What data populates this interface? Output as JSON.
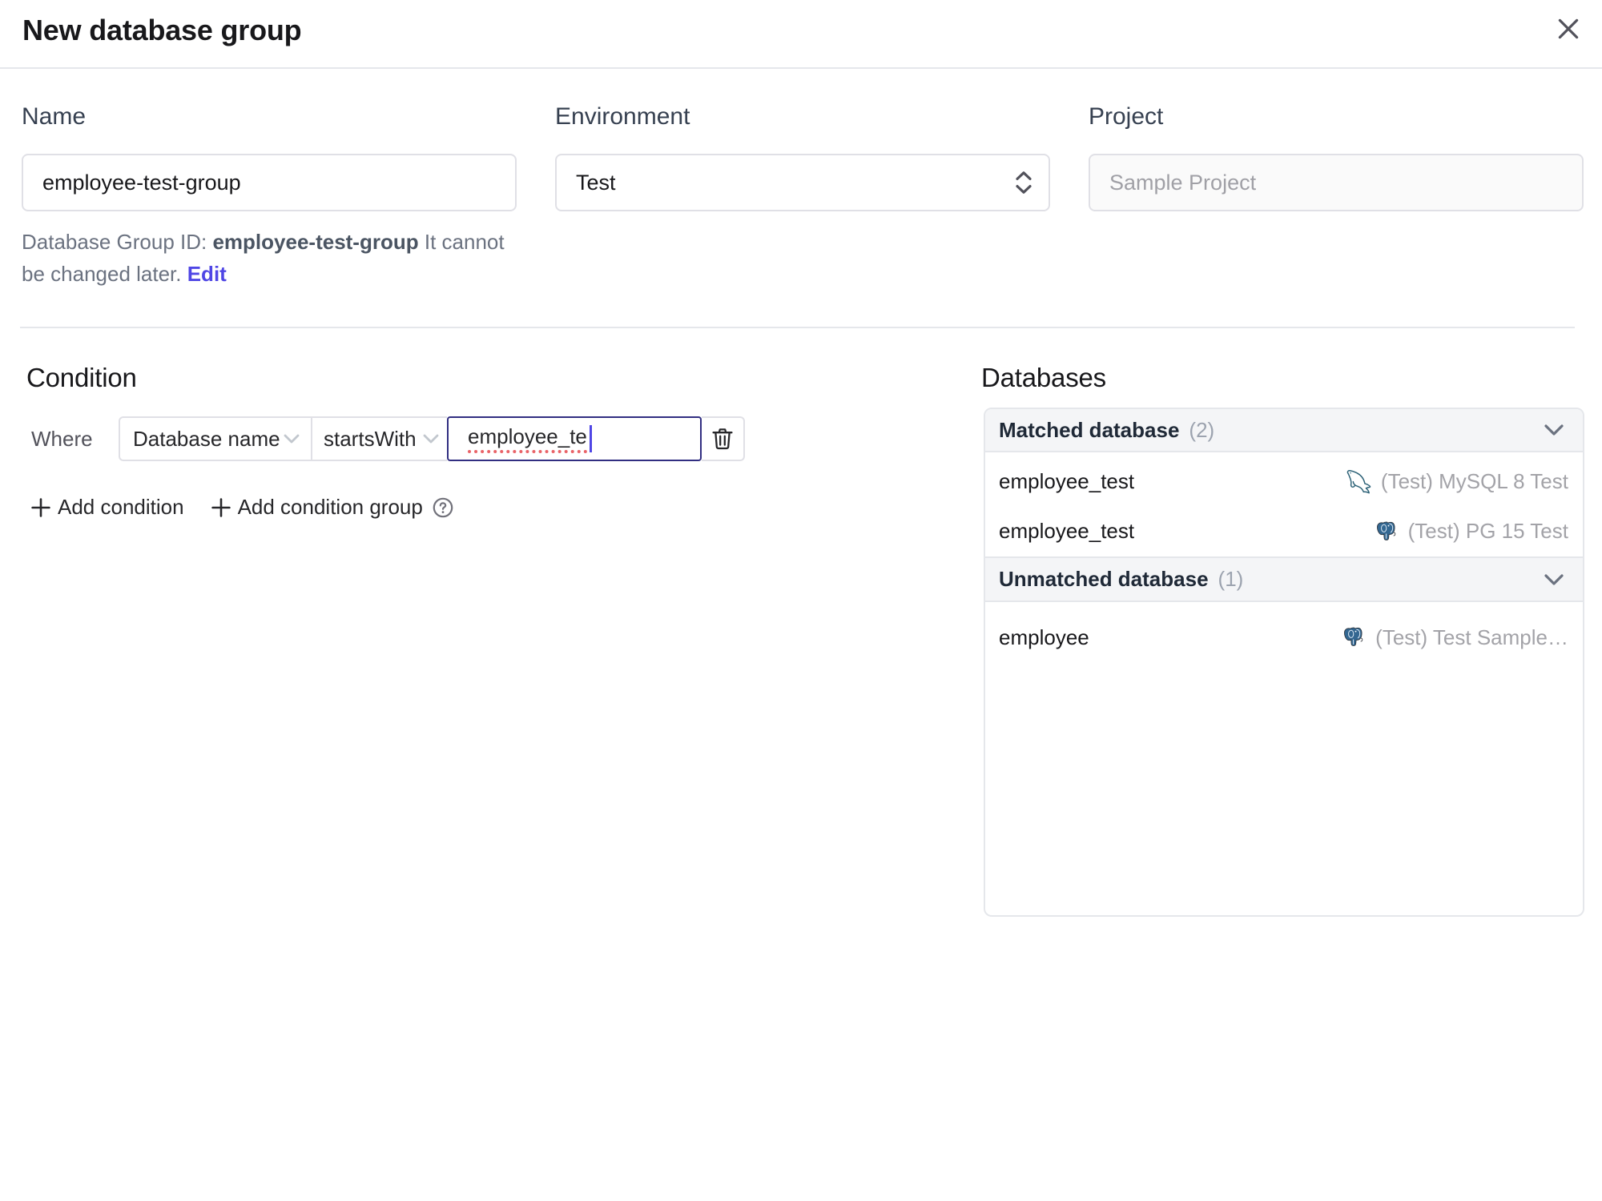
{
  "colors": {
    "accent": "#4f46e5",
    "focus-border": "#312e81",
    "border-input": "#e0e0e6",
    "border-soft": "#e5e7eb",
    "text-strong": "#18181b"
  },
  "dialog": {
    "title": "New database group"
  },
  "form": {
    "name": {
      "label": "Name",
      "value": "employee-test-group"
    },
    "environment": {
      "label": "Environment",
      "value": "Test"
    },
    "project": {
      "label": "Project",
      "value": "Sample Project"
    },
    "id_hint": {
      "prefix": "Database Group ID: ",
      "id": "employee-test-group",
      "suffix": " It cannot be changed later. ",
      "edit_label": "Edit"
    }
  },
  "condition": {
    "heading": "Condition",
    "where_label": "Where",
    "factor": "Database name",
    "operator": "startsWith",
    "value": "employee_te",
    "add_condition_label": "Add condition",
    "add_condition_group_label": "Add condition group"
  },
  "databases": {
    "heading": "Databases",
    "groups": [
      {
        "title": "Matched database",
        "count": "(2)",
        "rows": [
          {
            "name": "employee_test",
            "instance": "(Test) MySQL 8 Test",
            "engine": "mysql"
          },
          {
            "name": "employee_test",
            "instance": "(Test) PG 15 Test",
            "engine": "postgres"
          }
        ]
      },
      {
        "title": "Unmatched database",
        "count": "(1)",
        "rows": [
          {
            "name": "employee",
            "instance": "(Test) Test Sample…",
            "engine": "postgres"
          }
        ]
      }
    ]
  }
}
